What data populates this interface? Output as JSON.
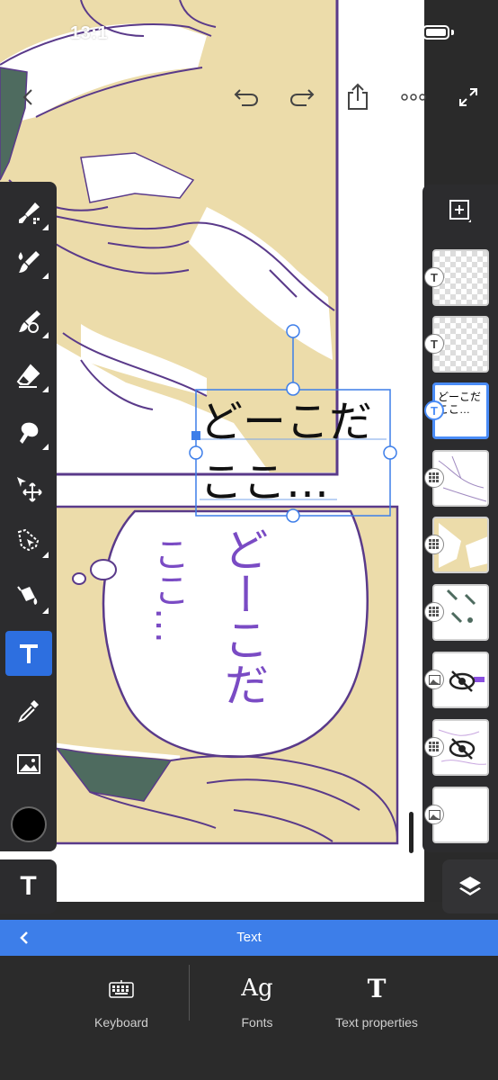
{
  "status_bar": {
    "time": "13:1"
  },
  "toolbar": {
    "back_icon": "chevron-left-icon",
    "undo_icon": "undo-icon",
    "redo_icon": "redo-icon",
    "share_icon": "share-icon",
    "more_icon": "more-icon",
    "fullscreen_icon": "expand-icon"
  },
  "canvas": {
    "text_box": {
      "line1": "どーこだ",
      "line2": "ここ…"
    },
    "speech_bubble": {
      "line_right": "どーこだ",
      "line_left": "ここ…"
    },
    "colors": {
      "skin": "#ecdcaa",
      "line": "#5a3a8a",
      "shadow": "#4e6b5f"
    }
  },
  "tools": [
    {
      "name": "pixel-brush",
      "icon": "pixel-brush-icon"
    },
    {
      "name": "live-brush",
      "icon": "live-brush-icon"
    },
    {
      "name": "vector-brush",
      "icon": "vector-brush-icon"
    },
    {
      "name": "eraser",
      "icon": "eraser-icon"
    },
    {
      "name": "smudge",
      "icon": "smudge-icon"
    },
    {
      "name": "transform",
      "icon": "transform-icon"
    },
    {
      "name": "lasso",
      "icon": "lasso-icon"
    },
    {
      "name": "fill",
      "icon": "fill-icon"
    },
    {
      "name": "text",
      "icon": "text-icon",
      "active": true,
      "label": "T"
    },
    {
      "name": "eyedropper",
      "icon": "eyedropper-icon"
    },
    {
      "name": "image",
      "icon": "image-icon"
    }
  ],
  "current_color": "#000000",
  "current_tool_label": "T",
  "layers": {
    "items": [
      {
        "type": "text",
        "badge": "T",
        "thumb_text": ""
      },
      {
        "type": "text",
        "badge": "T",
        "thumb_text": ""
      },
      {
        "type": "text",
        "badge": "T",
        "thumb_text": "どーこだ\nここ…",
        "selected": true
      },
      {
        "type": "pixel",
        "badge": "",
        "thumb_text": ""
      },
      {
        "type": "pixel",
        "badge": "",
        "thumb_text": ""
      },
      {
        "type": "pixel",
        "badge": "",
        "thumb_text": ""
      },
      {
        "type": "image",
        "badge": "",
        "thumb_text": "",
        "hidden": true
      },
      {
        "type": "pixel",
        "badge": "",
        "thumb_text": "",
        "hidden": true
      },
      {
        "type": "image",
        "badge": "",
        "thumb_text": ""
      }
    ]
  },
  "context_bar": {
    "title": "Text",
    "back": "‹"
  },
  "bottom_options": {
    "keyboard": "Keyboard",
    "fonts": "Fonts",
    "fonts_icon_text": "Ag",
    "text_properties": "Text properties",
    "text_properties_icon_text": "T"
  },
  "accent_color": "#3d7ee9"
}
